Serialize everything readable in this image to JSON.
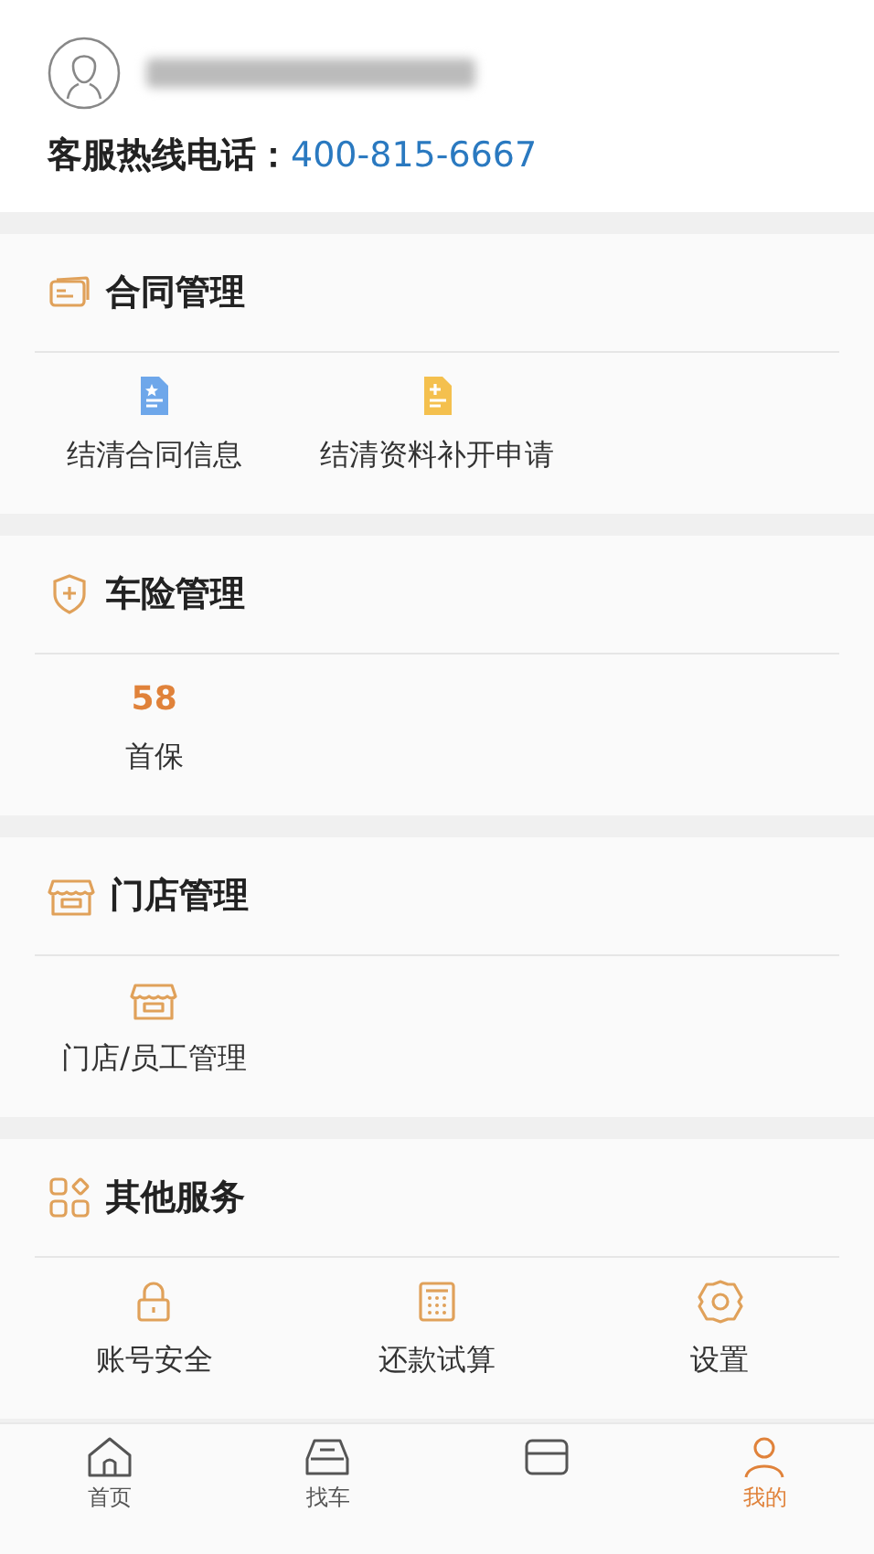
{
  "profile": {
    "hotline_label": "客服热线电话：",
    "hotline_number": "400-815-6667"
  },
  "sections": [
    {
      "title": "合同管理",
      "kind": "card",
      "items": [
        {
          "kind": "doc-star",
          "label": "结清合同信息"
        },
        {
          "kind": "doc-plus",
          "label": "结清资料补开申请"
        }
      ]
    },
    {
      "title": "车险管理",
      "kind": "shield",
      "items": [
        {
          "kind": "count",
          "count": "58",
          "label": "首保"
        }
      ]
    },
    {
      "title": "门店管理",
      "kind": "store",
      "items": [
        {
          "kind": "store",
          "label": "门店/员工管理"
        }
      ]
    },
    {
      "title": "其他服务",
      "kind": "apps",
      "items": [
        {
          "kind": "lock",
          "label": "账号安全"
        },
        {
          "kind": "calculator",
          "label": "还款试算"
        },
        {
          "kind": "gear",
          "label": "设置"
        }
      ]
    }
  ],
  "tabbar": [
    {
      "kind": "home",
      "label": "首页",
      "selected": false
    },
    {
      "kind": "car",
      "label": "找车",
      "selected": false
    },
    {
      "kind": "box",
      "selected": false
    },
    {
      "kind": "person",
      "label": "我的",
      "selected": true
    }
  ]
}
